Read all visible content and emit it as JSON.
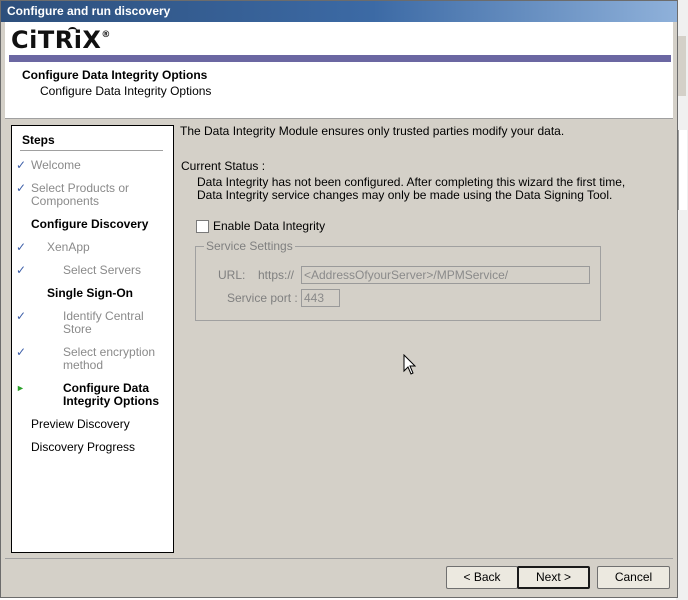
{
  "window": {
    "title": "Configure and run discovery"
  },
  "header": {
    "logo_text": "CiTRiX",
    "logo_mark": "®",
    "title": "Configure Data Integrity Options",
    "subtitle": "Configure Data Integrity Options",
    "accent_color": "#6b67a2"
  },
  "steps": {
    "title": "Steps",
    "items": [
      {
        "label": "Welcome",
        "state": "done",
        "icon": "check-icon"
      },
      {
        "label": "Select Products or\nComponents",
        "state": "done",
        "icon": "check-icon"
      },
      {
        "label": "Configure Discovery",
        "state": "section"
      },
      {
        "label": "XenApp",
        "state": "done",
        "icon": "check-icon"
      },
      {
        "label": "Select Servers",
        "state": "done",
        "icon": "check-icon"
      },
      {
        "label": "Single Sign-On",
        "state": "section"
      },
      {
        "label": "Identify Central\nStore",
        "state": "done",
        "icon": "check-icon"
      },
      {
        "label": "Select encryption\nmethod",
        "state": "done",
        "icon": "check-icon"
      },
      {
        "label": "Configure Data\nIntegrity Options",
        "state": "current",
        "icon": "arrow-icon"
      },
      {
        "label": "Preview Discovery",
        "state": "pending"
      },
      {
        "label": "Discovery Progress",
        "state": "pending"
      }
    ]
  },
  "main": {
    "intro": "The Data Integrity Module ensures only trusted parties modify your data.",
    "status_label": "Current Status :",
    "status_line1": "Data Integrity has not been configured. After completing this wizard the first time,",
    "status_line2": "Data Integrity service changes may only be made using the Data Signing Tool.",
    "enable_label": "Enable Data Integrity",
    "enable_checked": false,
    "service_settings": {
      "legend": "Service Settings",
      "url_label": "URL:",
      "url_prefix": "https://",
      "url_value": "<AddressOfyourServer>/MPMService/",
      "port_label": "Service port :",
      "port_value": "443"
    }
  },
  "buttons": {
    "back": "< Back",
    "next": "Next >",
    "cancel": "Cancel"
  }
}
